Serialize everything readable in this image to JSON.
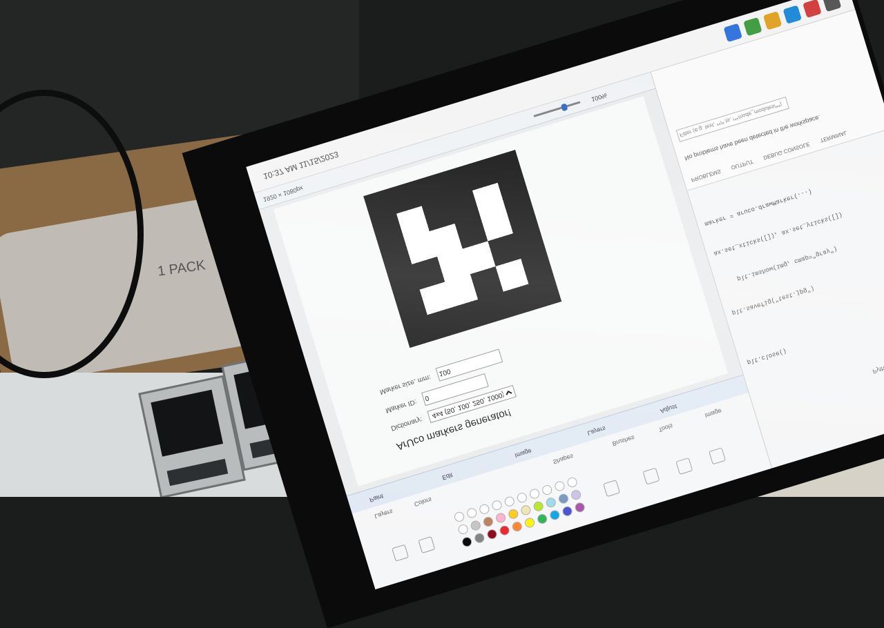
{
  "form": {
    "title": "ArUco markers generator!",
    "dictionary_label": "Dictionary:",
    "dictionary_value": "4x4 (50, 100, 250, 1000)",
    "dictionary_options": [
      "4x4 (50, 100, 250, 1000)"
    ],
    "marker_id_label": "Marker ID:",
    "marker_id_value": "0",
    "marker_size_label": "Marker size, mm:",
    "marker_size_value": "100"
  },
  "marker": {
    "grid": [
      [
        1,
        1,
        1,
        1,
        1,
        1
      ],
      [
        1,
        0,
        0,
        1,
        0,
        1
      ],
      [
        1,
        1,
        0,
        0,
        1,
        1
      ],
      [
        1,
        0,
        0,
        1,
        0,
        1
      ],
      [
        1,
        0,
        1,
        1,
        0,
        1
      ],
      [
        1,
        1,
        1,
        1,
        1,
        1
      ]
    ],
    "fg": "#000000",
    "bg": "#ffffff"
  },
  "paint": {
    "statusbar_zoom": "100%",
    "statusbar_dims": "1920 × 1080px",
    "ribbon_groups": [
      "Image",
      "Tools",
      "Brushes",
      "Shapes",
      "Colors",
      "Layers"
    ],
    "tabs": [
      "Paint",
      "Edit",
      "Image",
      "Layers",
      "Adjust"
    ]
  },
  "vscode": {
    "language": "Python",
    "code_lines": [
      "plt.close()",
      "",
      "plt.savefig(\"test.jpg\")",
      "    plt.imshow(img, cmap=\"gray\")",
      "ax.set_xticks([]), ax.set_yticks([])",
      "marker = aruco.drawMarker(...)"
    ],
    "panel_tabs": [
      "PROBLEMS",
      "OUTPUT",
      "DEBUG CONSOLE",
      "TERMINAL"
    ],
    "panel_message": "No problems have been detected in the workspace.",
    "filter_placeholder": "Filter (e.g. text, **/*.ts, !**/node_modules/**)"
  },
  "taskbar": {
    "time": "10:37 AM",
    "date": "11/15/2023",
    "app_icons": [
      "#2a6fdb",
      "#3c9a3c",
      "#e0a020",
      "#1b88d8",
      "#d23c3c",
      "#555555"
    ]
  },
  "palette_colors": [
    "#000000",
    "#7f7f7f",
    "#880015",
    "#ed1c24",
    "#ff7f27",
    "#fff200",
    "#22b14c",
    "#00a2e8",
    "#3f48cc",
    "#a349a4",
    "#ffffff",
    "#c3c3c3",
    "#b97a57",
    "#ffaec9",
    "#ffc90e",
    "#efe4b0",
    "#b5e61d",
    "#99d9ea",
    "#7092be",
    "#c8bfe7",
    "#ffffff",
    "#ffffff",
    "#ffffff",
    "#ffffff",
    "#ffffff",
    "#ffffff",
    "#ffffff",
    "#ffffff",
    "#ffffff",
    "#ffffff"
  ],
  "scene": {
    "pouch_label": "1 PACK"
  }
}
